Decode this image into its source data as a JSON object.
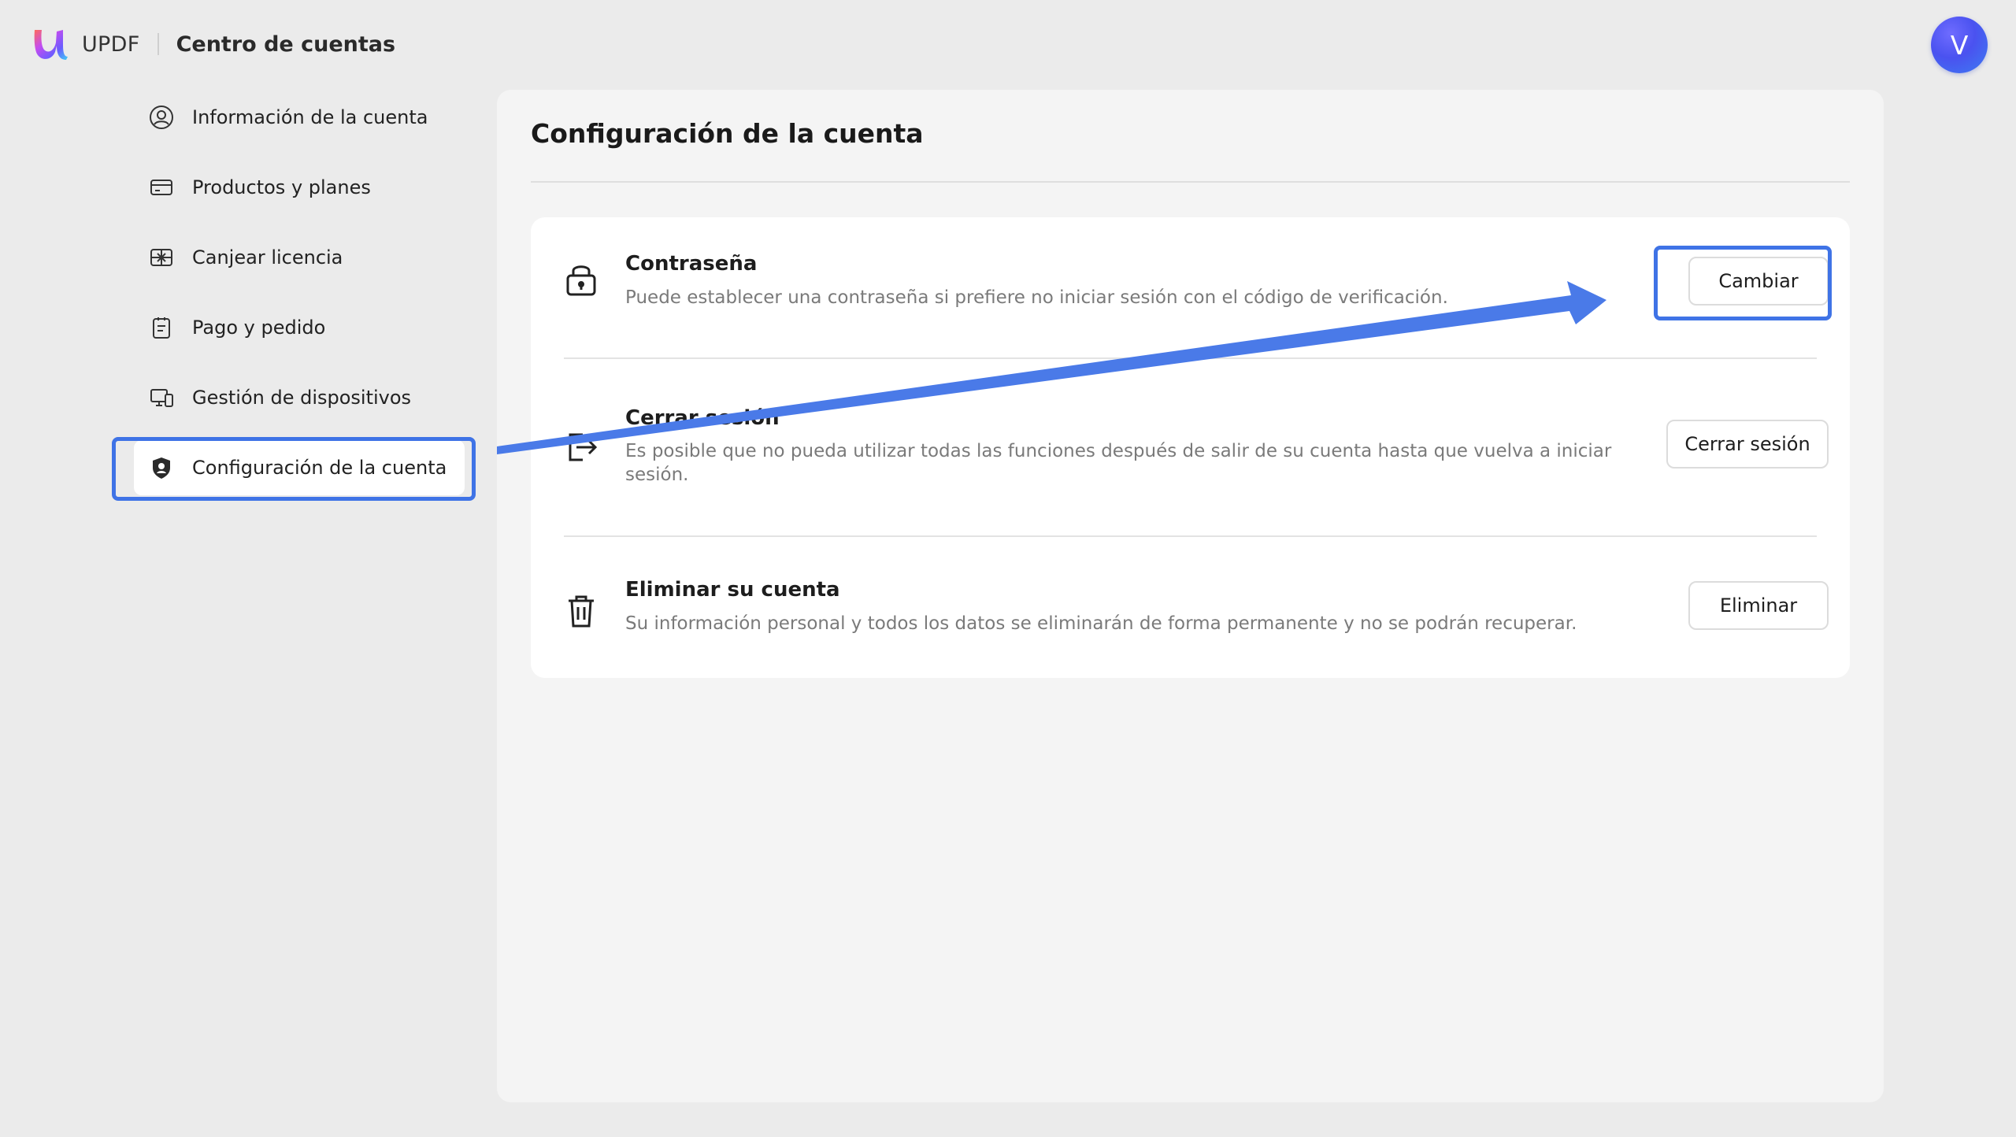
{
  "header": {
    "brand": "UPDF",
    "title": "Centro de cuentas",
    "avatar_initial": "V"
  },
  "sidebar": {
    "items": [
      {
        "label": "Información de la cuenta",
        "icon": "user-circle-icon"
      },
      {
        "label": "Productos y planes",
        "icon": "card-icon"
      },
      {
        "label": "Canjear licencia",
        "icon": "gift-icon"
      },
      {
        "label": "Pago y pedido",
        "icon": "clipboard-icon"
      },
      {
        "label": "Gestión de dispositivos",
        "icon": "devices-icon"
      },
      {
        "label": "Configuración de la cuenta",
        "icon": "shield-user-icon",
        "active": true
      }
    ]
  },
  "main": {
    "title": "Configuración de la cuenta",
    "rows": [
      {
        "title": "Contraseña",
        "description": "Puede establecer una contraseña si prefiere no iniciar sesión con el código de verificación.",
        "button": "Cambiar",
        "icon": "lock-icon"
      },
      {
        "title": "Cerrar sesión",
        "description": "Es posible que no pueda utilizar todas las funciones después de salir de su cuenta hasta que vuelva a iniciar sesión.",
        "button": "Cerrar sesión",
        "icon": "logout-icon"
      },
      {
        "title": "Eliminar su cuenta",
        "description": "Su información personal y todos los datos se eliminarán de forma permanente y no se podrán recuperar.",
        "button": "Eliminar",
        "icon": "trash-icon"
      }
    ]
  },
  "colors": {
    "highlight": "#3f73e6",
    "background": "#ebebeb",
    "panel": "#f4f4f4",
    "card": "#ffffff"
  }
}
